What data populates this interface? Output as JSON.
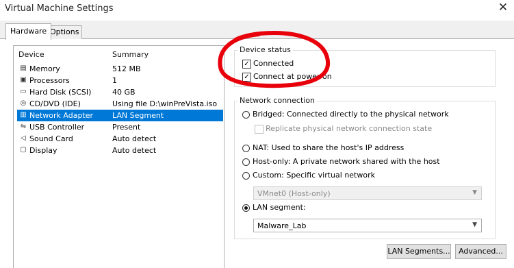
{
  "window": {
    "title": "Virtual Machine Settings",
    "close_glyph": "✕"
  },
  "tabs": [
    {
      "label": "Hardware",
      "active": true
    },
    {
      "label": "Options",
      "active": false
    }
  ],
  "device_list": {
    "columns": [
      "Device",
      "Summary"
    ],
    "rows": [
      {
        "icon": "memory-icon",
        "device": "Memory",
        "summary": "512 MB"
      },
      {
        "icon": "processor-icon",
        "device": "Processors",
        "summary": "1"
      },
      {
        "icon": "hard-disk-icon",
        "device": "Hard Disk (SCSI)",
        "summary": "40 GB"
      },
      {
        "icon": "cd-dvd-icon",
        "device": "CD/DVD (IDE)",
        "summary": "Using file D:\\winPreVista.iso"
      },
      {
        "icon": "network-adapter-icon",
        "device": "Network Adapter",
        "summary": "LAN Segment",
        "selected": true
      },
      {
        "icon": "usb-icon",
        "device": "USB Controller",
        "summary": "Present"
      },
      {
        "icon": "sound-card-icon",
        "device": "Sound Card",
        "summary": "Auto detect"
      },
      {
        "icon": "display-icon",
        "device": "Display",
        "summary": "Auto detect"
      }
    ]
  },
  "device_status": {
    "title": "Device status",
    "connected": {
      "label": "Connected",
      "checked": true
    },
    "connect_at_power_on": {
      "label": "Connect at power on",
      "checked": true
    }
  },
  "network_connection": {
    "title": "Network connection",
    "bridged": {
      "label": "Bridged: Connected directly to the physical network",
      "selected": false
    },
    "replicate": {
      "label": "Replicate physical network connection state",
      "checked": false,
      "enabled": false
    },
    "nat": {
      "label": "NAT: Used to share the host's IP address",
      "selected": false
    },
    "host_only": {
      "label": "Host-only: A private network shared with the host",
      "selected": false
    },
    "custom": {
      "label": "Custom: Specific virtual network",
      "selected": false
    },
    "custom_network": {
      "value": "VMnet0 (Host-only)",
      "enabled": false
    },
    "lan_segment": {
      "label": "LAN segment:",
      "selected": true
    },
    "lan_segment_value": {
      "value": "Malware_Lab"
    }
  },
  "buttons": {
    "lan_segments": "LAN Segments...",
    "advanced": "Advanced..."
  },
  "annotation_color": "#e8000b"
}
